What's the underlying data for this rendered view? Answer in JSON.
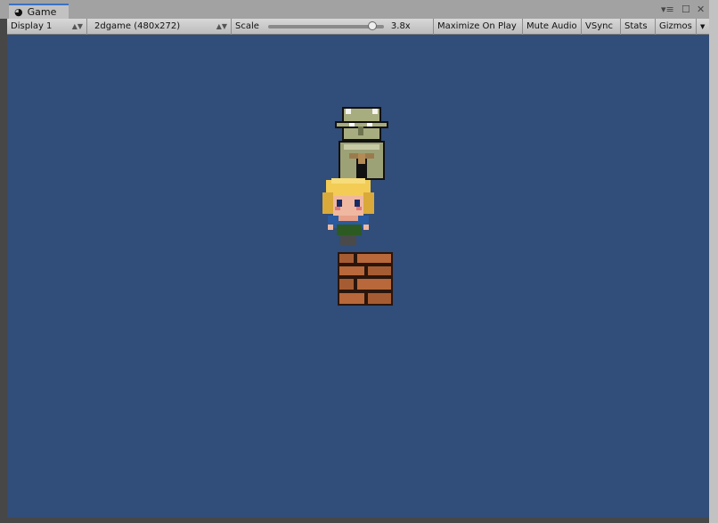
{
  "tab": {
    "title": "Game",
    "icon": "pacman-game-icon"
  },
  "window_controls": {
    "menu": "▾≡",
    "maximize": "☐",
    "close": "✕"
  },
  "toolbar": {
    "display": "Display 1",
    "resolution": "2dgame (480x272)",
    "scale_label": "Scale",
    "scale_value": "3.8x",
    "scale_fraction": 0.9,
    "maximize_on_play": "Maximize On Play",
    "mute_audio": "Mute Audio",
    "vsync": "VSync",
    "stats": "Stats",
    "gizmos": "Gizmos"
  },
  "colors": {
    "game_background": "#314d79",
    "tab_accent": "#3a72c4"
  }
}
